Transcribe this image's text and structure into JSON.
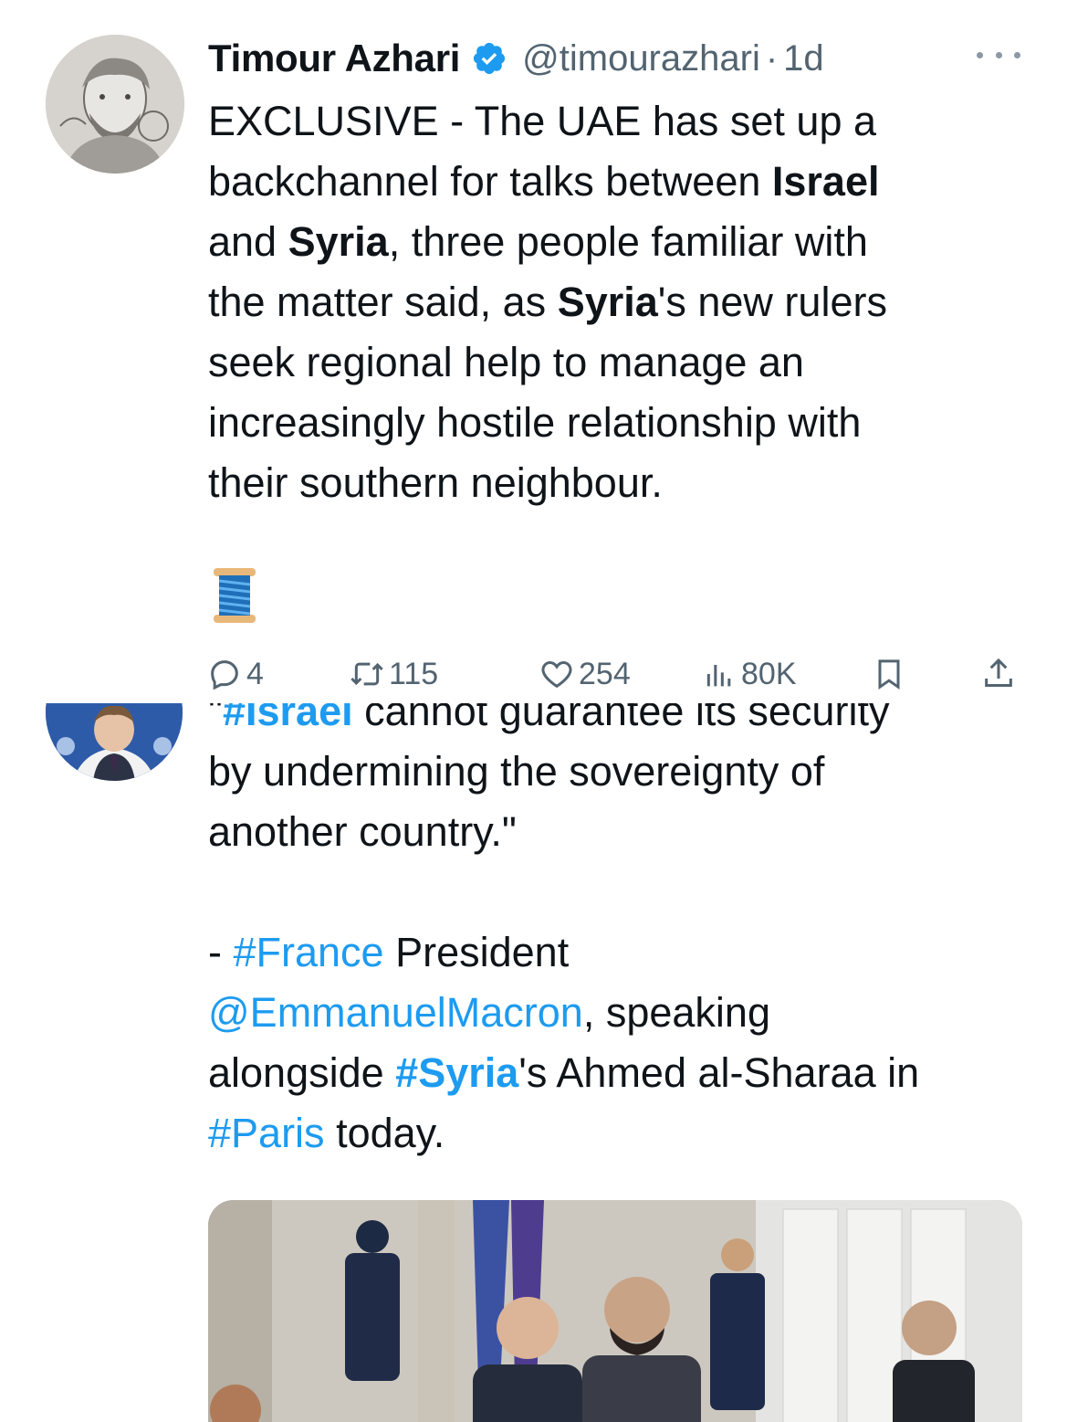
{
  "tweet1": {
    "author_name": "Timour Azhari",
    "handle": "@timourazhari",
    "separator": "·",
    "time": "1d",
    "text_lines": [
      [
        {
          "t": "EXCLUSIVE - The UAE has set up a",
          "b": false
        }
      ],
      [
        {
          "t": "backchannel for talks between ",
          "b": false
        },
        {
          "t": "Israel",
          "b": true
        }
      ],
      [
        {
          "t": "and ",
          "b": false
        },
        {
          "t": "Syria",
          "b": true
        },
        {
          "t": ", three people familiar with",
          "b": false
        }
      ],
      [
        {
          "t": "the matter said, as ",
          "b": false
        },
        {
          "t": "Syria",
          "b": true
        },
        {
          "t": "'s new rulers",
          "b": false
        }
      ],
      [
        {
          "t": "seek regional help to manage an",
          "b": false
        }
      ],
      [
        {
          "t": "increasingly hostile relationship with",
          "b": false
        }
      ],
      [
        {
          "t": "their southern neighbour.",
          "b": false
        }
      ]
    ],
    "emoji": "spool-of-thread",
    "actions": {
      "replies": "4",
      "reposts": "115",
      "likes": "254",
      "views": "80K"
    }
  },
  "tweet2": {
    "text_lines": [
      [
        {
          "t": "\"",
          "k": "plain"
        },
        {
          "t": "#Israel",
          "k": "tagb"
        },
        {
          "t": " cannot guarantee its security",
          "k": "plain"
        }
      ],
      [
        {
          "t": "by undermining the sovereignty of",
          "k": "plain"
        }
      ],
      [
        {
          "t": "another country.\"",
          "k": "plain"
        }
      ],
      [],
      [
        {
          "t": "- ",
          "k": "plain"
        },
        {
          "t": "#France",
          "k": "tag"
        },
        {
          "t": " President",
          "k": "plain"
        }
      ],
      [
        {
          "t": "@EmmanuelMacron",
          "k": "tag"
        },
        {
          "t": ", speaking",
          "k": "plain"
        }
      ],
      [
        {
          "t": "alongside ",
          "k": "plain"
        },
        {
          "t": "#Syria",
          "k": "tagb"
        },
        {
          "t": "'s Ahmed al-Sharaa in",
          "k": "plain"
        }
      ],
      [
        {
          "t": "#Paris",
          "k": "tag"
        },
        {
          "t": " today.",
          "k": "plain"
        }
      ]
    ],
    "photo": "press-photo"
  },
  "colors": {
    "text": "#0f1419",
    "secondary": "#536471",
    "link": "#1d9bf0",
    "verified": "#1d9bf0"
  }
}
